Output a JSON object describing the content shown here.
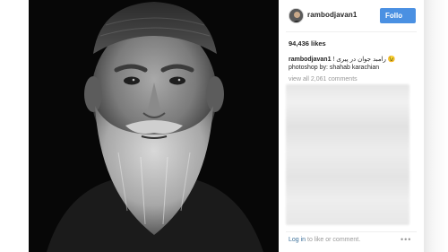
{
  "post": {
    "username": "rambodjavan1",
    "follow_label": "Follo",
    "likes": "94,436 likes",
    "caption_user": "rambodjavan1",
    "caption_text": "! رامبد جوان در پیری 😉",
    "caption_credit": "photoshop by: shahab karachian",
    "view_all": "view all 2,061 comments",
    "login_link": "Log in",
    "login_rest": " to like or comment.",
    "more_label": "•••"
  },
  "colors": {
    "follow_button": "#4a90e2",
    "link": "#3f729b",
    "muted_text": "#999999",
    "photo_background": "#070707"
  },
  "icons": {
    "more": "more-options-icon"
  }
}
